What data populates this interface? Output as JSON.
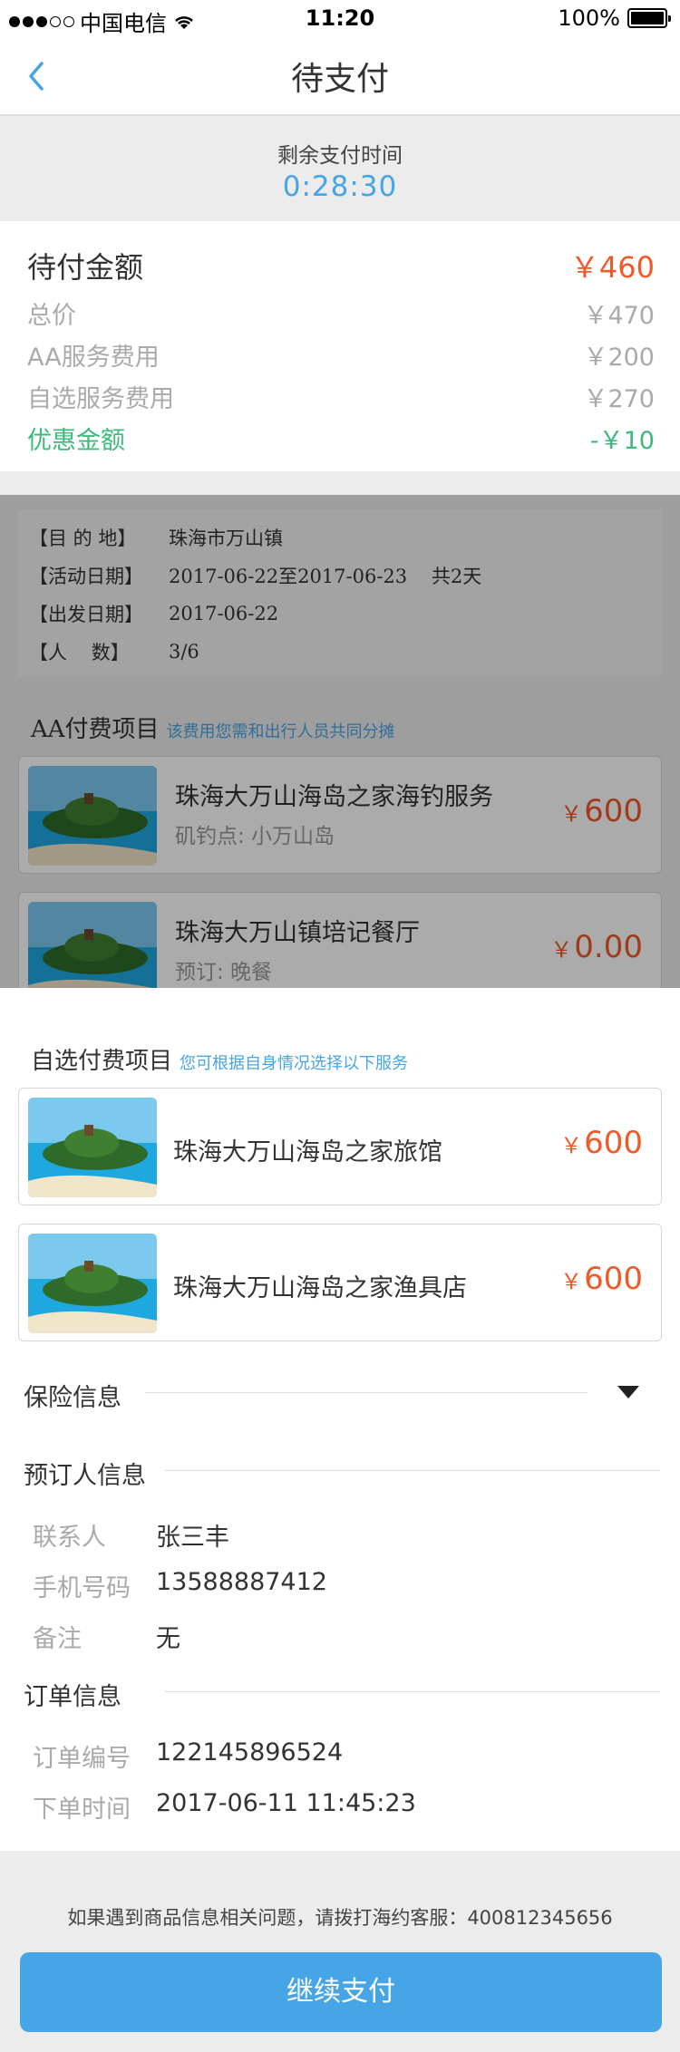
{
  "status_bar": {
    "carrier": "中国电信",
    "time": "11:20",
    "battery": "100%"
  },
  "nav": {
    "title": "待支付"
  },
  "timer": {
    "label": "剩余支付时间",
    "value": "0:28:30"
  },
  "amounts": [
    {
      "label": "待付金额",
      "value": "￥460"
    },
    {
      "label": "总价",
      "value": "￥470"
    },
    {
      "label": "AA服务费用",
      "value": "￥200"
    },
    {
      "label": "自选服务费用",
      "value": "￥270"
    },
    {
      "label": "优惠金额",
      "value": "-￥10"
    }
  ],
  "destination": [
    {
      "key": "【目 的 地】",
      "value": "珠海市万山镇"
    },
    {
      "key": "【活动日期】",
      "value": "2017-06-22至2017-06-23    共2天"
    },
    {
      "key": "【出发日期】",
      "value": "2017-06-22"
    },
    {
      "key": "【人    数】",
      "value": "3/6"
    }
  ],
  "aa_section": {
    "title": "AA付费项目",
    "hint": "该费用您需和出行人员共同分摊",
    "items": [
      {
        "name": "珠海大万山海岛之家海钓服务",
        "sub": "矶钓点:  小万山岛",
        "currency": "￥",
        "price": "600"
      },
      {
        "name": "珠海大万山镇培记餐厅",
        "sub": "预订:  晚餐",
        "currency": "￥",
        "price": "0.00"
      }
    ]
  },
  "optional_section": {
    "title": "自选付费项目",
    "hint": "您可根据自身情况选择以下服务",
    "items": [
      {
        "name": "珠海大万山海岛之家旅馆",
        "currency": "￥",
        "price": "600"
      },
      {
        "name": "珠海大万山海岛之家渔具店",
        "currency": "￥",
        "price": "600"
      }
    ]
  },
  "insurance": {
    "title": "保险信息"
  },
  "booker": {
    "title": "预订人信息",
    "rows": [
      {
        "label": "联系人",
        "value": "张三丰"
      },
      {
        "label": "手机号码",
        "value": "13588887412"
      },
      {
        "label": "备注",
        "value": "无"
      }
    ]
  },
  "order": {
    "title": "订单信息",
    "rows": [
      {
        "label": "订单编号",
        "value": "122145896524"
      },
      {
        "label": "下单时间",
        "value": "2017-06-11  11:45:23"
      }
    ]
  },
  "footer": {
    "note": "如果遇到商品信息相关问题，请拨打海约客服：400812345656",
    "pay_button": "继续支付"
  },
  "colors": {
    "accent": "#45a5e6",
    "price": "#f05a28",
    "discount": "#3cba7c"
  },
  "icons": [
    "back-chevron-icon",
    "wifi-icon",
    "battery-icon",
    "dropdown-triangle-icon"
  ]
}
